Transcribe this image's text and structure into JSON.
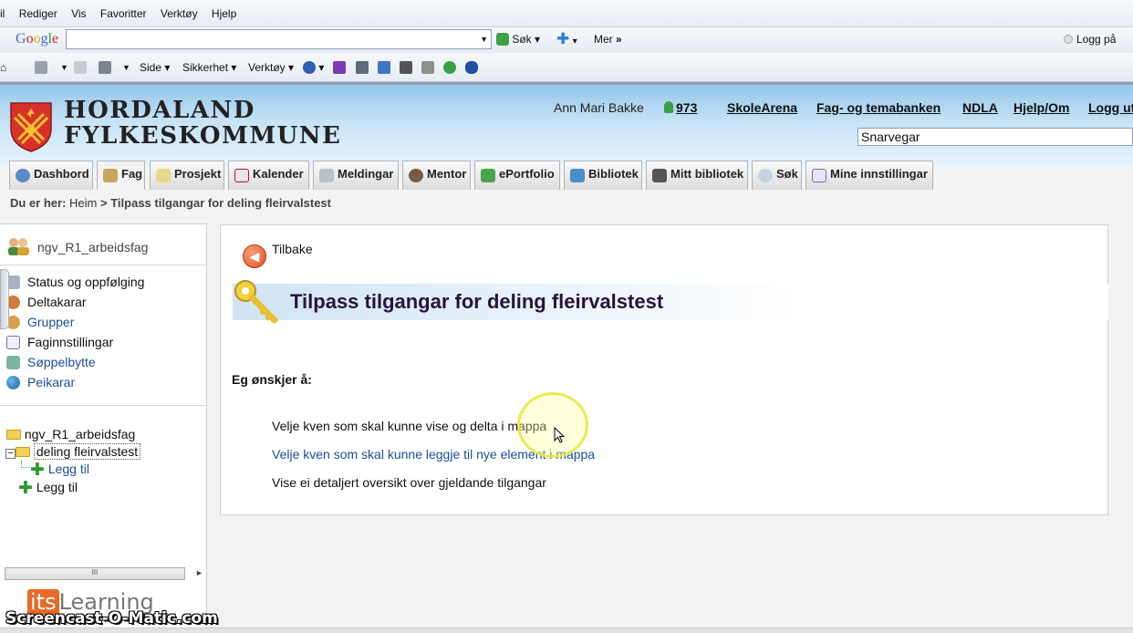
{
  "browser": {
    "menu": [
      "il",
      "Rediger",
      "Vis",
      "Favoritter",
      "Verktøy",
      "Hjelp"
    ],
    "google": {
      "logo": [
        "G",
        "o",
        "o",
        "g",
        "l",
        "e"
      ],
      "search_value": "",
      "search_btn": "Søk",
      "more": "Mer",
      "login": "Logg på"
    },
    "commands": {
      "page": "Side",
      "safety": "Sikkerhet",
      "tools": "Verktøy"
    }
  },
  "site": {
    "org_line1": "HORDALAND",
    "org_line2": "FYLKESKOMMUNE",
    "user": "Ann Mari Bakke",
    "points": "973",
    "links": [
      "SkoleArena",
      "Fag- og temabanken",
      "NDLA",
      "Hjelp/Om",
      "Logg ut"
    ],
    "shortcut_value": "Snarvegar"
  },
  "tabs": [
    "Dashbord",
    "Fag",
    "Prosjekt",
    "Kalender",
    "Meldingar",
    "Mentor",
    "ePortfolio",
    "Bibliotek",
    "Mitt bibliotek",
    "Søk",
    "Mine innstillingar"
  ],
  "breadcrumb": {
    "prefix": "Du er her:",
    "home": "Heim",
    "sep": ">",
    "current": "Tilpass tilgangar for deling fleirvalstest"
  },
  "sidebar": {
    "course": "ngv_R1_arbeidsfag",
    "items": [
      "Status og oppfølging",
      "Deltakarar",
      "Grupper",
      "Faginnstillingar",
      "Søppelbytte",
      "Peikarar"
    ],
    "tree": {
      "root": "ngv_R1_arbeidsfag",
      "folder": "deling fleirvalstest",
      "add_child": "Legg til",
      "add_root": "Legg til"
    },
    "scroll_grip": "III",
    "logo_its": "its",
    "logo_rest": "Learning"
  },
  "main": {
    "back": "Tilbake",
    "title": "Tilpass tilgangar for deling fleirvalstest",
    "intro": "Eg ønskjer å:",
    "options": [
      "Velje kven som skal kunne vise og delta i mappa",
      "Velje kven som skal kunne leggje til nye element i mappa",
      "Vise ei detaljert oversikt over gjeldande tilgangar"
    ]
  },
  "watermark": "Screencast-O-Matic.com",
  "colors": {
    "header_blue": "#93c6ea",
    "link_blue": "#1b4f9c",
    "title_purple": "#2a1240",
    "crest_red": "#d8312a",
    "back_orange": "#e04e1f"
  }
}
